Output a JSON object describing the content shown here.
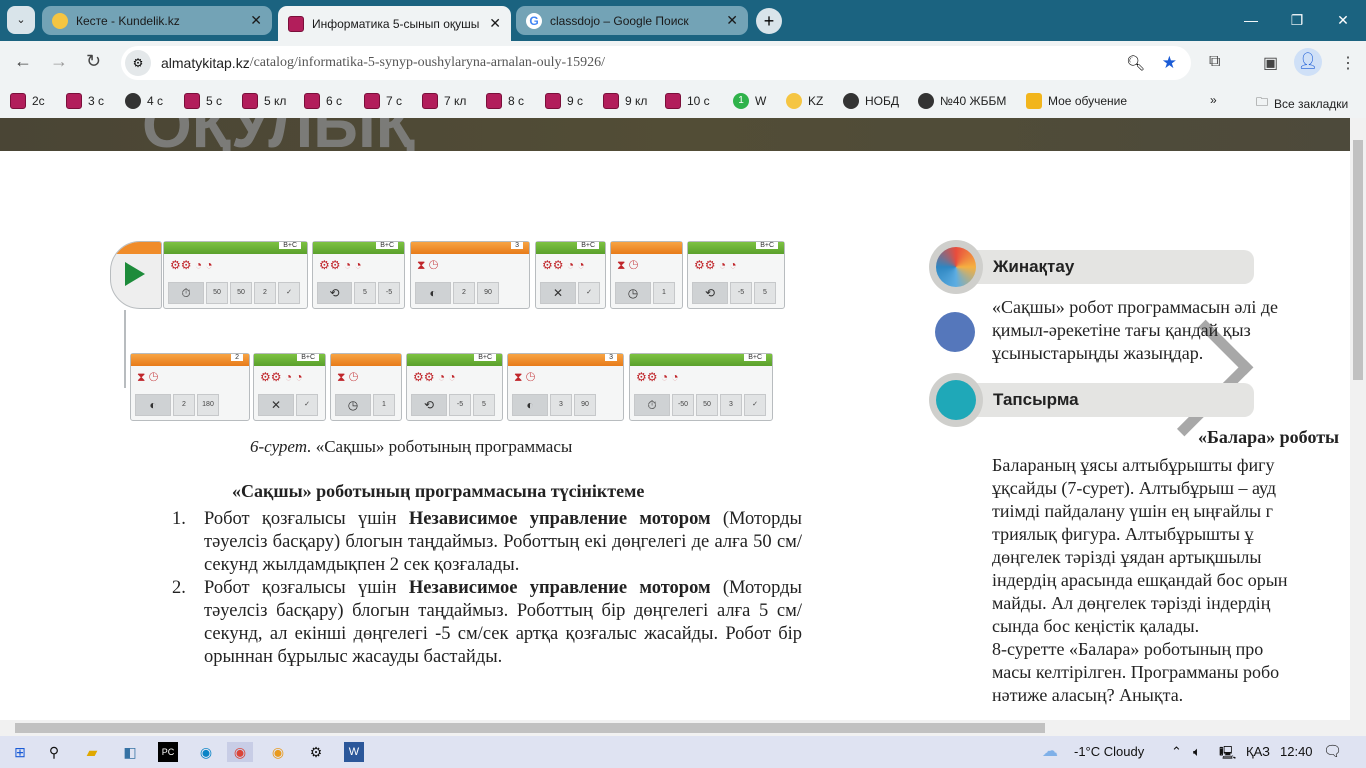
{
  "browser": {
    "tabs": [
      {
        "title": "Кесте - Kundelik.kz",
        "icon": "kundelik-icon"
      },
      {
        "title": "Информатика 5-сынып оқушы",
        "icon": "almatykitap-icon",
        "active": true
      },
      {
        "title": "classdojo – Google Поиск",
        "icon": "google-icon"
      }
    ],
    "url_host": "almatykitap.kz",
    "url_path": "/catalog/informatika-5-synyp-oushylaryna-arnalan-ouly-15926/",
    "bookmarks": [
      {
        "label": "2с",
        "icon": "book"
      },
      {
        "label": "3 с",
        "icon": "book"
      },
      {
        "label": "4 с",
        "icon": "globe"
      },
      {
        "label": "5 с",
        "icon": "book"
      },
      {
        "label": "5 кл",
        "icon": "book"
      },
      {
        "label": "6 с",
        "icon": "book"
      },
      {
        "label": "7 с",
        "icon": "book"
      },
      {
        "label": "7 кл",
        "icon": "book"
      },
      {
        "label": "8 с",
        "icon": "book"
      },
      {
        "label": "9 с",
        "icon": "book"
      },
      {
        "label": "9 кл",
        "icon": "book"
      },
      {
        "label": "10 с",
        "icon": "book"
      },
      {
        "label": "W",
        "icon": "whatsapp"
      },
      {
        "label": "KZ",
        "icon": "kundelik"
      },
      {
        "label": "НОБД",
        "icon": "nobd"
      },
      {
        "label": "№40 ЖББМ",
        "icon": "globe"
      },
      {
        "label": "Мое обучение",
        "icon": "s4u"
      }
    ],
    "all_bookmarks": "Все закладки"
  },
  "page": {
    "banner_text": "ОҚУЛЫҚ",
    "program_blocks": [
      {
        "type": "motor",
        "port": "B+C",
        "mode": "⏱",
        "values": [
          "50",
          "50",
          "2",
          "✓"
        ]
      },
      {
        "type": "motor",
        "port": "B+C",
        "mode": "⟲",
        "values": [
          "5",
          "-5"
        ]
      },
      {
        "type": "wait",
        "port": "3",
        "mode": "◐",
        "values": [
          "2",
          "90"
        ]
      },
      {
        "type": "motor",
        "port": "B+C",
        "mode": "✕",
        "values": [
          "✓"
        ]
      },
      {
        "type": "wait",
        "port": "",
        "mode": "◷",
        "values": [
          "1"
        ]
      },
      {
        "type": "motor",
        "port": "B+C",
        "mode": "⟲",
        "values": [
          "-5",
          "5"
        ]
      },
      {
        "type": "wait",
        "port": "2",
        "mode": "◐",
        "values": [
          "2",
          "180"
        ]
      },
      {
        "type": "motor",
        "port": "B+C",
        "mode": "✕",
        "values": [
          "✓"
        ]
      },
      {
        "type": "wait",
        "port": "",
        "mode": "◷",
        "values": [
          "1"
        ]
      },
      {
        "type": "motor",
        "port": "B+C",
        "mode": "⟲",
        "values": [
          "-5",
          "5"
        ]
      },
      {
        "type": "wait",
        "port": "3",
        "mode": "◐",
        "values": [
          "3",
          "90"
        ]
      },
      {
        "type": "motor",
        "port": "B+C",
        "mode": "⏱",
        "values": [
          "-50",
          "50",
          "3",
          "✓"
        ]
      }
    ],
    "caption_num": "6-сурет.",
    "caption_text": " «Сақшы» роботының программасы",
    "heading": "«Сақшы» роботының программасына түсініктеме",
    "items": [
      {
        "n": "1.",
        "pre": "Робот қозғалысы үшін ",
        "bold": "Независимое управление мотором",
        "post": " (Моторды тәуелсіз басқару) блогын таңдаймыз. Роботтың екі дөңгелегі де алға 50 см/секунд жылдамдықпен 2 сек қозғалады."
      },
      {
        "n": "2.",
        "pre": "Робот қозғалысы үшін ",
        "bold": "Независимое управление мотором",
        "post": " (Моторды тәуелсіз басқару) блогын таңдаймыз. Роботтың бір дөңгелегі алға 5 см/секунд, ал екінші дөңгелегі -5 см/сек артқа қозғалыс жасайды. Робот бір орыннан бұрылыс жасауды бастайды."
      }
    ],
    "side": {
      "section1": "Жинақтау",
      "section1_lines": [
        "«Сақшы» робот программасын әлі де",
        "қимыл-әрекетіне тағы қандай қыз",
        "ұсыныстарыңды жазыңдар."
      ],
      "section2": "Тапсырма",
      "section2_title": "«Балара» роботы",
      "section2_lines": [
        "Балараның ұясы алтыбұрышты фигу",
        "ұқсайды (7-сурет). Алтыбұрыш – ауд",
        "тиімді пайдалану үшін ең ыңғайлы г",
        "триялық фигура. Алтыбұрышты ұ",
        "дөңгелек тәрізді ұядан артықшылы",
        "індердің арасында ешқандай бос орын",
        "майды. Ал дөңгелек тәрізді індердің",
        "сында бос кеңістік қалады.",
        "8-суретте «Балара» роботының про",
        "масы келтірілген. Программаны робо",
        "нәтиже аласың? Анықта."
      ]
    }
  },
  "taskbar": {
    "weather": "-1°C  Cloudy",
    "lang": "ҚАЗ",
    "time": "12:40"
  }
}
